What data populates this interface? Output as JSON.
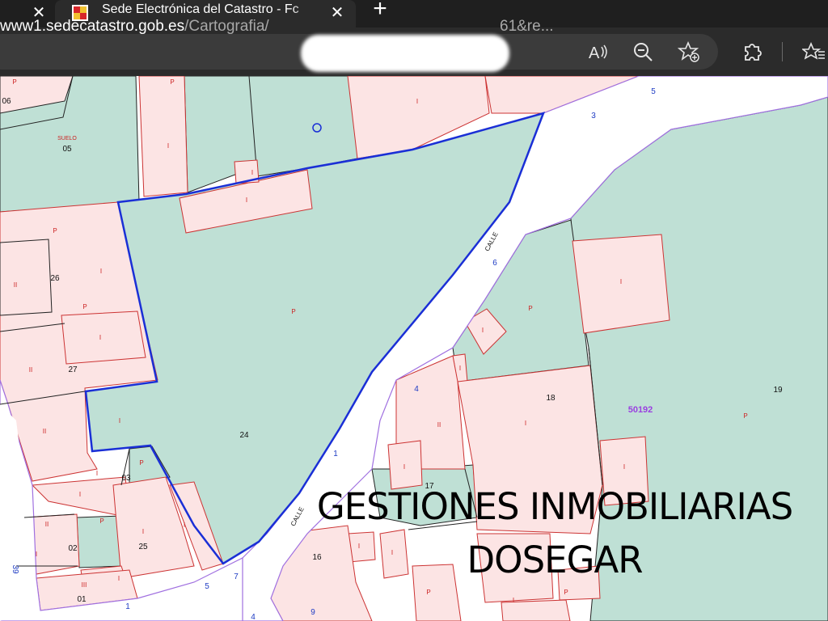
{
  "browser": {
    "tab": {
      "title": "Sede Electrónica del Catastro - Fc"
    },
    "url": {
      "domain": "www1.sedecatastro.gob.es",
      "path": "/Cartografia/",
      "end": "61&re..."
    }
  },
  "map": {
    "parcels": {
      "p05": "05",
      "p05_label": "SUELO",
      "p06": "06",
      "p26": "26",
      "p27": "27",
      "p24": "24",
      "p03": "03",
      "p02": "02",
      "p25": "25",
      "p01": "01",
      "p18": "18",
      "p17": "17",
      "p16": "16",
      "p19": "19",
      "block": "50192"
    },
    "streets": {
      "calle_top": "CALLE",
      "calle_bottom": "CALLE",
      "n3": "3",
      "n5": "5",
      "n6": "6",
      "n4": "4",
      "n1": "1",
      "n5b": "5",
      "n7": "7",
      "n1b": "1",
      "n4b": "4",
      "n9": "9",
      "n39": "39"
    },
    "use_codes": {
      "i": "I",
      "ii": "II",
      "iii": "III",
      "p": "P"
    }
  },
  "watermark": {
    "line1": "GESTIONES INMOBILIARIAS",
    "line2": "DOSEGAR"
  },
  "colors": {
    "parcel_green": "#bfe0d5",
    "building_pink": "#fce4e4",
    "boundary_blue": "#1a2fd6",
    "street_edge": "#a070e0",
    "parcel_red": "#d03030"
  }
}
